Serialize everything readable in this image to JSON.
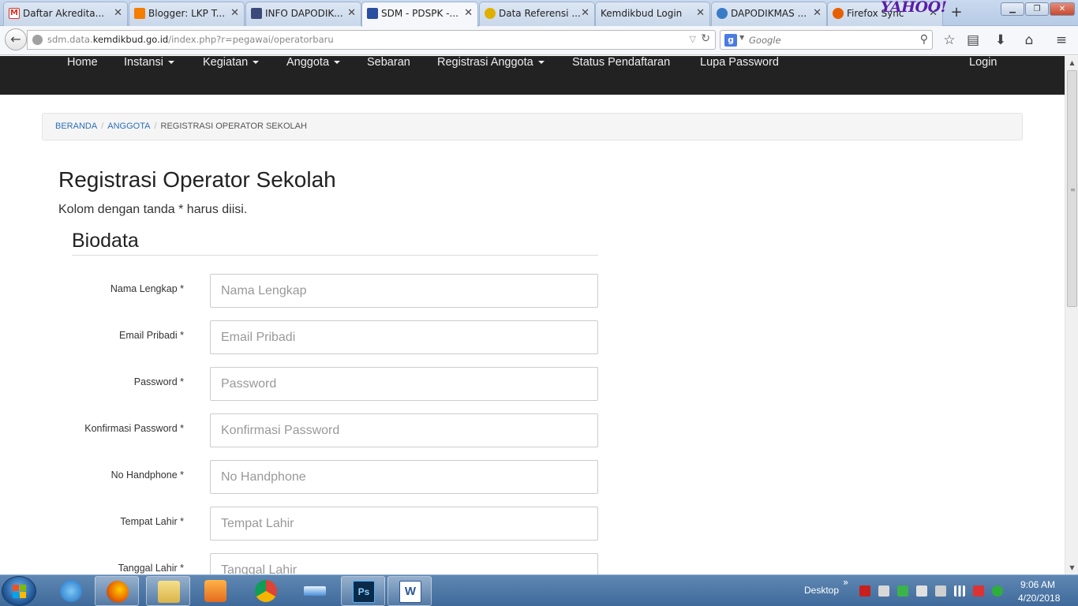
{
  "browser": {
    "tabs": [
      {
        "label": "Daftar Akredita...",
        "favicon_color": "#d93025",
        "favicon": "gmail-icon"
      },
      {
        "label": "Blogger: LKP T...",
        "favicon_color": "#f57d00",
        "favicon": "blogger-icon"
      },
      {
        "label": "INFO DAPODIK...",
        "favicon_color": "#3c4a7a",
        "favicon": "dapodik-icon"
      },
      {
        "label": "SDM - PDSPK -...",
        "favicon_color": "#2a4fa0",
        "favicon": "kemdikbud-icon"
      },
      {
        "label": "Data Referensi ...",
        "favicon_color": "#e0b000",
        "favicon": "referensi-icon"
      },
      {
        "label": "Kemdikbud Login",
        "favicon_color": "",
        "favicon": ""
      },
      {
        "label": "DAPODIKMAS ...",
        "favicon_color": "#3a7bc8",
        "favicon": "dapodikmas-icon"
      },
      {
        "label": "Firefox Sync",
        "favicon_color": "#e66000",
        "favicon": "firefox-icon"
      }
    ],
    "yahoo": "YAHOO!",
    "url_prefix": "sdm.data.",
    "url_domain": "kemdikbud.go.id",
    "url_suffix": "/index.php?r=pegawai/operatorbaru",
    "search_placeholder": "Google"
  },
  "site_nav": {
    "items": [
      {
        "label": "Home",
        "dropdown": false
      },
      {
        "label": "Instansi",
        "dropdown": true
      },
      {
        "label": "Kegiatan",
        "dropdown": true
      },
      {
        "label": "Anggota",
        "dropdown": true
      },
      {
        "label": "Sebaran",
        "dropdown": false
      },
      {
        "label": "Registrasi Anggota",
        "dropdown": true
      },
      {
        "label": "Status Pendaftaran",
        "dropdown": false
      },
      {
        "label": "Lupa Password",
        "dropdown": false
      }
    ],
    "login": "Login"
  },
  "breadcrumb": {
    "items": [
      "BERANDA",
      "ANGGOTA"
    ],
    "active": "REGISTRASI OPERATOR SEKOLAH",
    "separator": "/"
  },
  "main": {
    "title": "Registrasi Operator Sekolah",
    "note": "Kolom dengan tanda * harus diisi.",
    "section": "Biodata",
    "fields": [
      {
        "label": "Nama Lengkap *",
        "placeholder": "Nama Lengkap",
        "value": ""
      },
      {
        "label": "Email Pribadi *",
        "placeholder": "Email Pribadi",
        "value": ""
      },
      {
        "label": "Password *",
        "placeholder": "Password",
        "value": ""
      },
      {
        "label": "Konfirmasi Password *",
        "placeholder": "Konfirmasi Password",
        "value": ""
      },
      {
        "label": "No Handphone *",
        "placeholder": "No Handphone",
        "value": ""
      },
      {
        "label": "Tempat Lahir *",
        "placeholder": "Tempat Lahir",
        "value": ""
      },
      {
        "label": "Tanggal Lahir *",
        "placeholder": "Tanggal Lahir",
        "value": ""
      }
    ]
  },
  "taskbar": {
    "desktop": "Desktop",
    "time": "9:06 AM",
    "date": "4/20/2018",
    "apps": [
      "internet-explorer-icon",
      "firefox-icon",
      "file-explorer-icon",
      "media-player-icon",
      "chrome-icon",
      "scanner-icon",
      "photoshop-icon",
      "word-icon"
    ]
  },
  "colors": {
    "site_nav_bg": "#222222",
    "link": "#2a6fb8",
    "taskbar": "#3f6a9a"
  }
}
